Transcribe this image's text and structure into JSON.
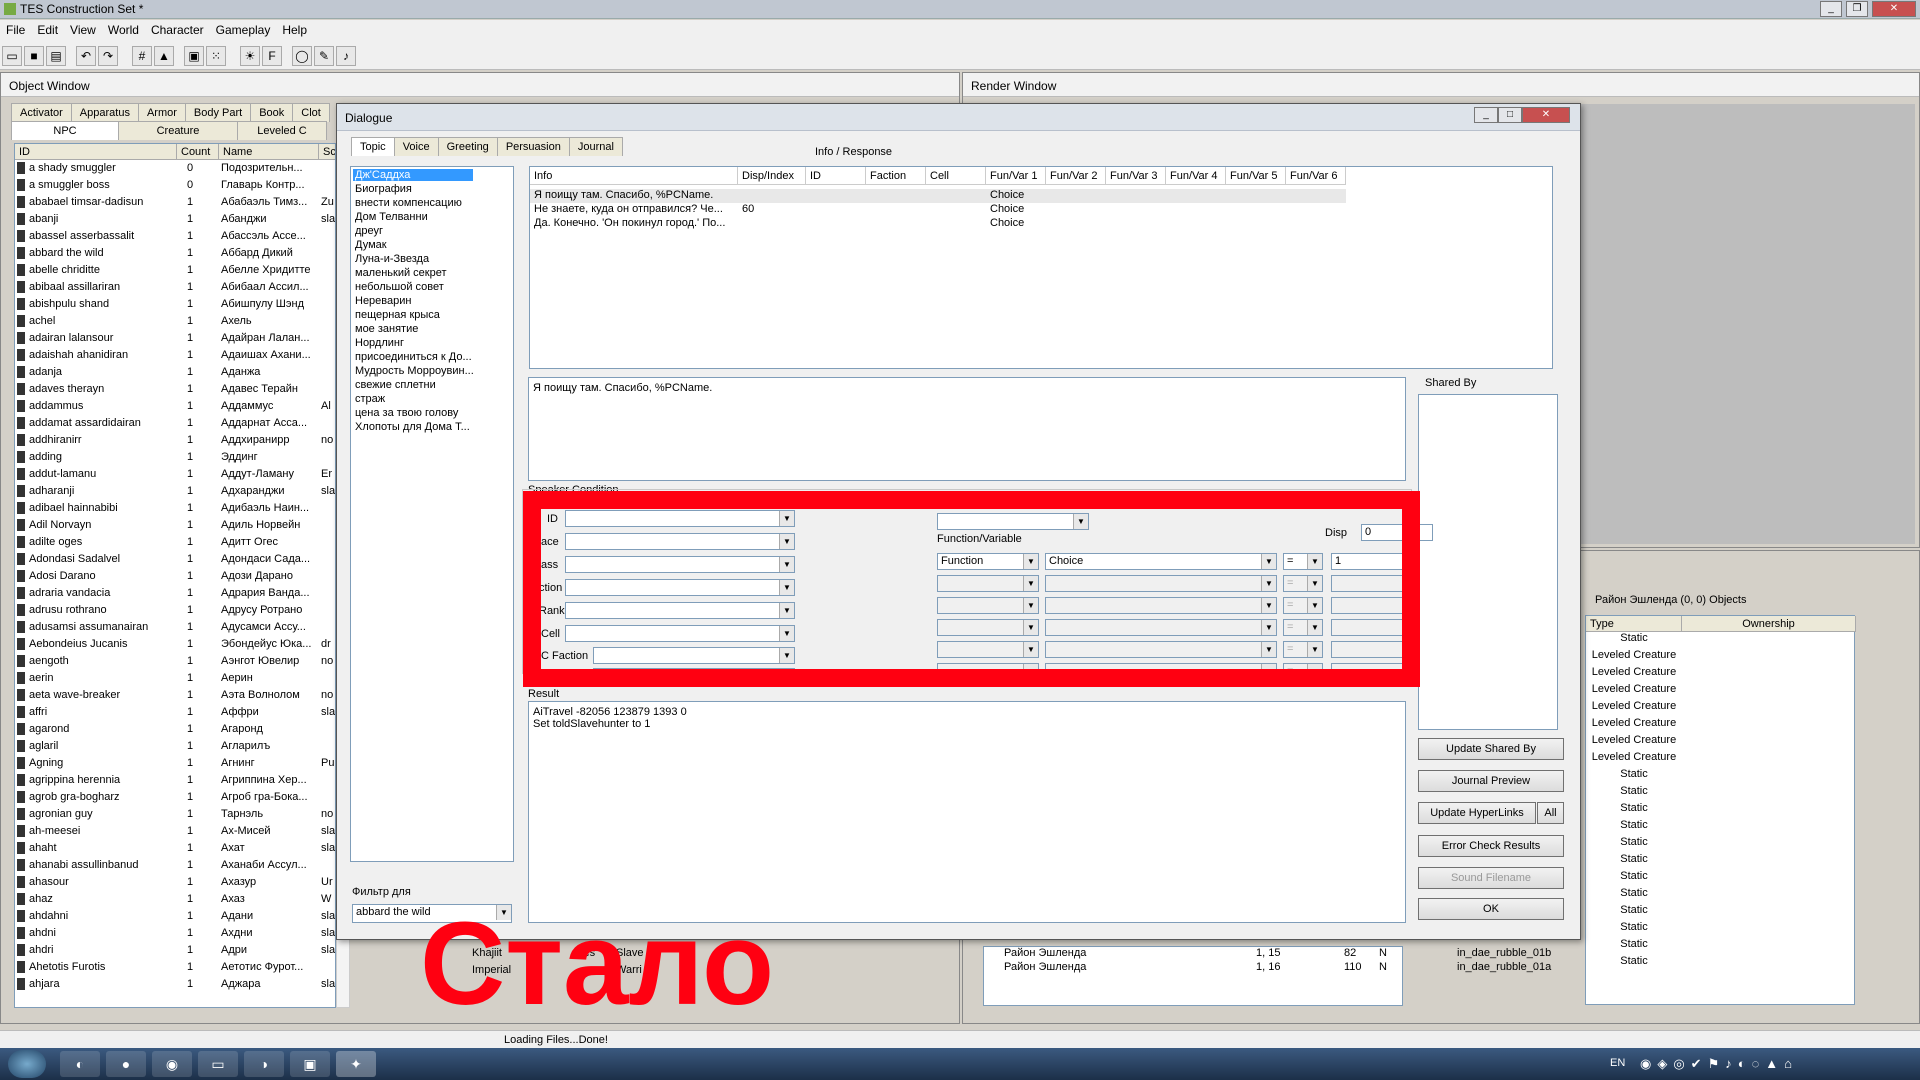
{
  "app": {
    "title": "TES Construction Set *",
    "controls": [
      "_",
      "❐",
      "✕"
    ]
  },
  "menu": [
    "File",
    "Edit",
    "View",
    "World",
    "Character",
    "Gameplay",
    "Help"
  ],
  "object_window": {
    "title": "Object Window",
    "tabs_row1": [
      "Activator",
      "Apparatus",
      "Armor",
      "Body Part",
      "Book",
      "Clot"
    ],
    "tabs_row2": [
      "NPC",
      "Creature",
      "Leveled C"
    ],
    "columns": [
      "ID",
      "Count",
      "Name",
      "Sc"
    ],
    "rows": [
      [
        "a shady smuggler",
        "0",
        "Подозрительн...",
        ""
      ],
      [
        "a smuggler boss",
        "0",
        "Главарь Контр...",
        ""
      ],
      [
        "ababael timsar-dadisun",
        "1",
        "Абабаэль Тимз...",
        "Zu"
      ],
      [
        "abanji",
        "1",
        "Абанджи",
        "sla"
      ],
      [
        "abassel asserbassalit",
        "1",
        "Абассэль Ассе...",
        ""
      ],
      [
        "abbard the wild",
        "1",
        "Аббард Дикий",
        ""
      ],
      [
        "abelle chriditte",
        "1",
        "Абелле Хридитте",
        ""
      ],
      [
        "abibaal assillariran",
        "1",
        "Абибаал Ассил...",
        ""
      ],
      [
        "abishpulu shand",
        "1",
        "Абишпулу Шэнд",
        ""
      ],
      [
        "achel",
        "1",
        "Ахель",
        ""
      ],
      [
        "adairan lalansour",
        "1",
        "Адайран Лалан...",
        ""
      ],
      [
        "adaishah ahanidiran",
        "1",
        "Адаишах Ахани...",
        ""
      ],
      [
        "adanja",
        "1",
        "Аданжа",
        ""
      ],
      [
        "adaves therayn",
        "1",
        "Адавес Терайн",
        ""
      ],
      [
        "addammus",
        "1",
        "Аддаммус",
        "Al"
      ],
      [
        "addamat assardidairan",
        "1",
        "Аддарнат Асса...",
        ""
      ],
      [
        "addhiranirr",
        "1",
        "Аддхиранирр",
        "no"
      ],
      [
        "adding",
        "1",
        "Эддинг",
        ""
      ],
      [
        "addut-lamanu",
        "1",
        "Аддут-Ламану",
        "Er"
      ],
      [
        "adharanji",
        "1",
        "Адхаранджи",
        "sla"
      ],
      [
        "adibael hainnabibi",
        "1",
        "Адибаэль Наин...",
        ""
      ],
      [
        "Adil Norvayn",
        "1",
        "Адиль Норвейн",
        ""
      ],
      [
        "adilte oges",
        "1",
        "Адитт Огес",
        ""
      ],
      [
        "Adondasi Sadalvel",
        "1",
        "Адондаси Сада...",
        ""
      ],
      [
        "Adosi Darano",
        "1",
        "Адози Дарано",
        ""
      ],
      [
        "adraria vandacia",
        "1",
        "Адрария Ванда...",
        ""
      ],
      [
        "adrusu rothrano",
        "1",
        "Адрусу Ротрано",
        ""
      ],
      [
        "adusamsi assumanairan",
        "1",
        "Адусамси Ассу...",
        ""
      ],
      [
        "Aebondeius Jucanis",
        "1",
        "Эбондейус Юка...",
        "dr"
      ],
      [
        "aengoth",
        "1",
        "Аэнгот Ювелир",
        "no"
      ],
      [
        "aerin",
        "1",
        "Аерин",
        ""
      ],
      [
        "aeta wave-breaker",
        "1",
        "Аэта Волнолом",
        "no"
      ],
      [
        "affri",
        "1",
        "Аффри",
        "sla"
      ],
      [
        "agarond",
        "1",
        "Агаронд",
        ""
      ],
      [
        "aglaril",
        "1",
        "Агларилъ",
        ""
      ],
      [
        "Agning",
        "1",
        "Агнинг",
        "Pu"
      ],
      [
        "agrippina herennia",
        "1",
        "Агриппина Хер...",
        ""
      ],
      [
        "agrob gra-bogharz",
        "1",
        "Агроб гра-Бока...",
        ""
      ],
      [
        "agronian guy",
        "1",
        "Тарнэль",
        "no"
      ],
      [
        "ah-meesei",
        "1",
        "Ах-Мисей",
        "sla"
      ],
      [
        "ahaht",
        "1",
        "Ахат",
        "sla"
      ],
      [
        "ahanabi assullinbanud",
        "1",
        "Аханаби Ассул...",
        ""
      ],
      [
        "ahasour",
        "1",
        "Ахазур",
        "Ur"
      ],
      [
        "ahaz",
        "1",
        "Ахаз",
        "W"
      ],
      [
        "ahdahni",
        "1",
        "Адани",
        "sla"
      ],
      [
        "ahdni",
        "1",
        "Ахдни",
        "sla"
      ],
      [
        "ahdri",
        "1",
        "Адри",
        "slaveScript"
      ],
      [
        "Ahetotis Furotis",
        "1",
        "Аетотис Фурот...",
        ""
      ],
      [
        "ahjara",
        "1",
        "Аджара",
        "slaveScript"
      ]
    ]
  },
  "render_window": {
    "title": "Render Window"
  },
  "cell_view": {
    "title": "Район Эшленда (0, 0) Objects",
    "columns": [
      "Type",
      "Ownership"
    ],
    "types": [
      "Static",
      "Leveled Creature",
      "Leveled Creature",
      "Leveled Creature",
      "Leveled Creature",
      "Leveled Creature",
      "Leveled Creature",
      "Leveled Creature",
      "Static",
      "Static",
      "Static",
      "Static",
      "Static",
      "Static",
      "Static",
      "Static",
      "Static",
      "Static",
      "Static",
      "Static"
    ],
    "bottom_rows": [
      [
        "Район Эшленда",
        "1, 15",
        "82",
        "N"
      ],
      [
        "Район Эшленда",
        "1, 16",
        "110",
        "N"
      ]
    ],
    "bottom_objects": [
      "in_dae_rubble_01b",
      "in_dae_rubble_01a"
    ],
    "bottom_behind": [
      "Khajiit",
      "Imperial",
      "yes",
      "Slave",
      "Warri"
    ]
  },
  "dialogue": {
    "title": "Dialogue",
    "tabs": [
      "Topic",
      "Voice",
      "Greeting",
      "Persuasion",
      "Journal"
    ],
    "info_response_label": "Info / Response",
    "topics": [
      "Дж'Саддха",
      "Биография",
      "внести компенсацию",
      "Дом Телванни",
      "дреуг",
      "Думак",
      "Луна-и-Звезда",
      "маленький секрет",
      "небольшой совет",
      "Нереварин",
      "пещерная крыса",
      "мое занятие",
      "Нордлинг",
      "присоединиться к До...",
      "Мудрость Морроувин...",
      "свежие сплетни",
      "страж",
      "цена за твою голову",
      "Хлопоты для Дома Т..."
    ],
    "grid_columns": [
      "Info",
      "Disp/Index",
      "ID",
      "Faction",
      "Cell",
      "Fun/Var 1",
      "Fun/Var 2",
      "Fun/Var 3",
      "Fun/Var 4",
      "Fun/Var 5",
      "Fun/Var 6"
    ],
    "grid_rows": [
      {
        "info": "Я поищу там. Спасибо, %PCName.",
        "disp": "",
        "f1": "Choice"
      },
      {
        "info": "Не знаете, куда он отправился? Че...",
        "disp": "60",
        "f1": "Choice"
      },
      {
        "info": "Да. Конечно. 'Он покинул город.' По...",
        "disp": "",
        "f1": "Choice"
      }
    ],
    "response_text": "Я поищу там. Спасибо, %PCName.",
    "shared_by_label": "Shared By",
    "speaker_condition_label": "Speaker Condition",
    "cond_labels": [
      "ID",
      "ace",
      "ass",
      "ction",
      "Rank",
      "Cell",
      "C Faction",
      "C Rank"
    ],
    "function_variable_label": "Function/Variable",
    "disp_label": "Disp",
    "disp_value": "0",
    "func_type": "Function",
    "func_name": "Choice",
    "func_op": "=",
    "func_value": "1",
    "op_disabled": "=",
    "result_label": "Result",
    "result_lines": [
      "AiTravel -82056 123879 1393 0",
      "Set toldSlavehunter to 1"
    ],
    "filter_label": "Фильтр для",
    "filter_value": "abbard the wild",
    "buttons": {
      "update_shared": "Update Shared By",
      "journal_preview": "Journal Preview",
      "update_hyperlinks": "Update HyperLinks",
      "all": "All",
      "error_check": "Error Check Results",
      "sound_filename": "Sound Filename",
      "ok": "OK"
    },
    "window_controls": [
      "_",
      "□",
      "✕"
    ]
  },
  "overlay_text": "Стало",
  "status_text": "Loading Files...Done!",
  "tray": {
    "lang": "EN"
  },
  "colors": {
    "highlight": "#ff0011",
    "selection": "#3399ff"
  }
}
